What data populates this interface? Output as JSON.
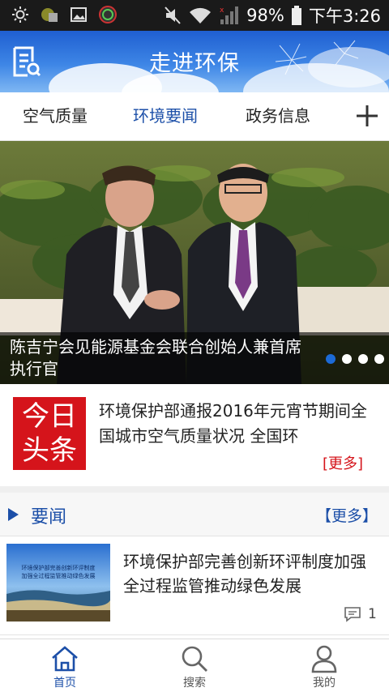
{
  "status_bar": {
    "battery_percent": "98%",
    "time": "下午3:26",
    "icons": [
      "brightness-icon",
      "image-icon",
      "gallery-icon",
      "meter-icon",
      "mute-icon",
      "wifi-icon",
      "signal-icon",
      "battery-icon"
    ]
  },
  "header": {
    "title": "走进环保",
    "menu_icon": "document-list-icon"
  },
  "tabs": {
    "items": [
      {
        "label": "空气质量",
        "active": false
      },
      {
        "label": "环境要闻",
        "active": true
      },
      {
        "label": "政务信息",
        "active": false
      }
    ],
    "add_icon": "plus-icon"
  },
  "banner": {
    "caption": "陈吉宁会见能源基金会联合创始人兼首席执行官",
    "slide_count": 4,
    "active_slide": 1
  },
  "headline": {
    "badge_line1": "今日",
    "badge_line2": "头条",
    "text": "环境保护部通报2016年元宵节期间全国城市空气质量状况 全国环",
    "more": "[更多]"
  },
  "news_section": {
    "title": "要闻",
    "more": "【更多】",
    "items": [
      {
        "title": "环境保护部完善创新环评制度加强全过程监管推动绿色发展",
        "thumb_text_line1": "环境保护部完善创新环评制度",
        "thumb_text_line2": "加强全过程监管推动绿色发展",
        "comments": "1"
      }
    ]
  },
  "bottom_nav": {
    "items": [
      {
        "label": "首页",
        "icon": "home-icon",
        "active": true
      },
      {
        "label": "搜索",
        "icon": "search-icon",
        "active": false
      },
      {
        "label": "我的",
        "icon": "user-icon",
        "active": false
      }
    ]
  },
  "colors": {
    "accent": "#1c4fa8",
    "badge_red": "#d5141b",
    "header_blue": "#2f74df"
  }
}
